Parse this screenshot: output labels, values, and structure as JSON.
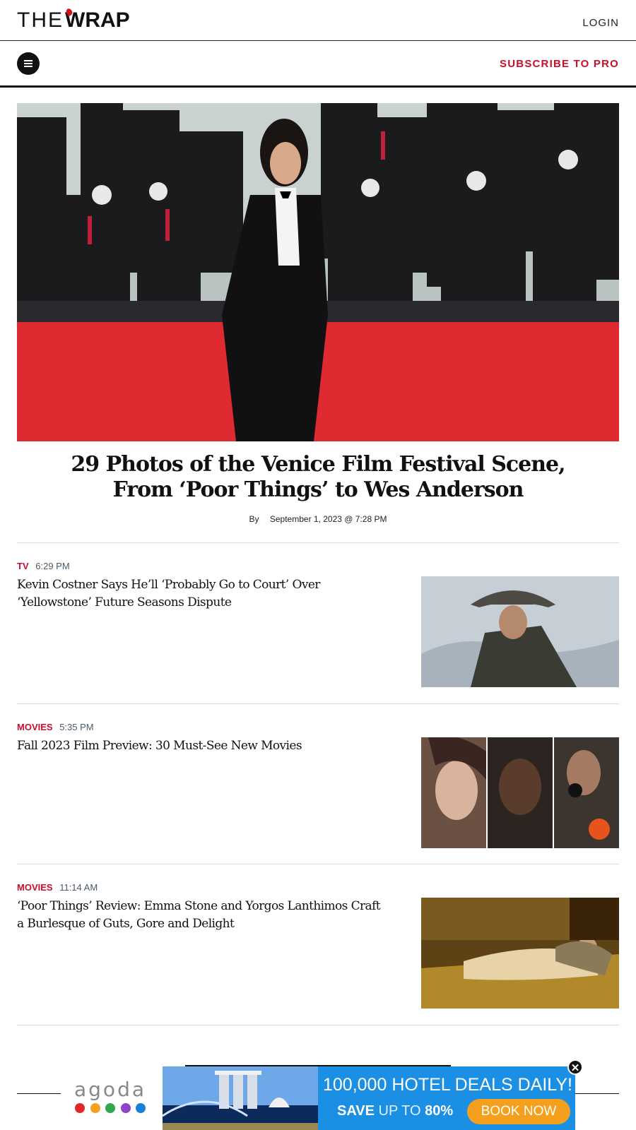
{
  "header": {
    "logo_the": "THE",
    "logo_wrap": "WRAP",
    "login_label": "LOGIN"
  },
  "navbar": {
    "menu_icon": "hamburger-menu-icon",
    "subscribe_label": "SUBSCRIBE TO PRO"
  },
  "hero": {
    "title": "29 Photos of the Venice Film Festival Scene, From ‘Poor Things’ to Wes Anderson",
    "by_label": "By",
    "date": "September 1, 2023 @ 7:28 PM"
  },
  "articles": [
    {
      "category": "TV",
      "time": "6:29 PM",
      "headline": "Kevin Costner Says He’ll ‘Probably Go to Court’ Over ‘Yellowstone’ Future Seasons Dispute"
    },
    {
      "category": "MOVIES",
      "time": "5:35 PM",
      "headline": "Fall 2023 Film Preview: 30 Must-See New Movies"
    },
    {
      "category": "MOVIES",
      "time": "11:14 AM",
      "headline": "‘Poor Things’ Review: Emma Stone and Yorgos Lanthimos Craft a Burlesque of Guts, Gore and Delight"
    }
  ],
  "ad": {
    "brand": "agoda",
    "headline": "100,000 HOTEL DEALS DAILY!",
    "save_word": "SAVE",
    "upto": "UP TO",
    "percent": "80%",
    "cta": "BOOK NOW",
    "close_icon": "close-icon",
    "brand_dot_colors": [
      "#e4252a",
      "#f4a21d",
      "#2fa84f",
      "#8e44c8",
      "#1a7fd6"
    ]
  },
  "colors": {
    "accent": "#c8102e",
    "ad_blue": "#1a8fe3",
    "ad_orange": "#f5a01d"
  }
}
